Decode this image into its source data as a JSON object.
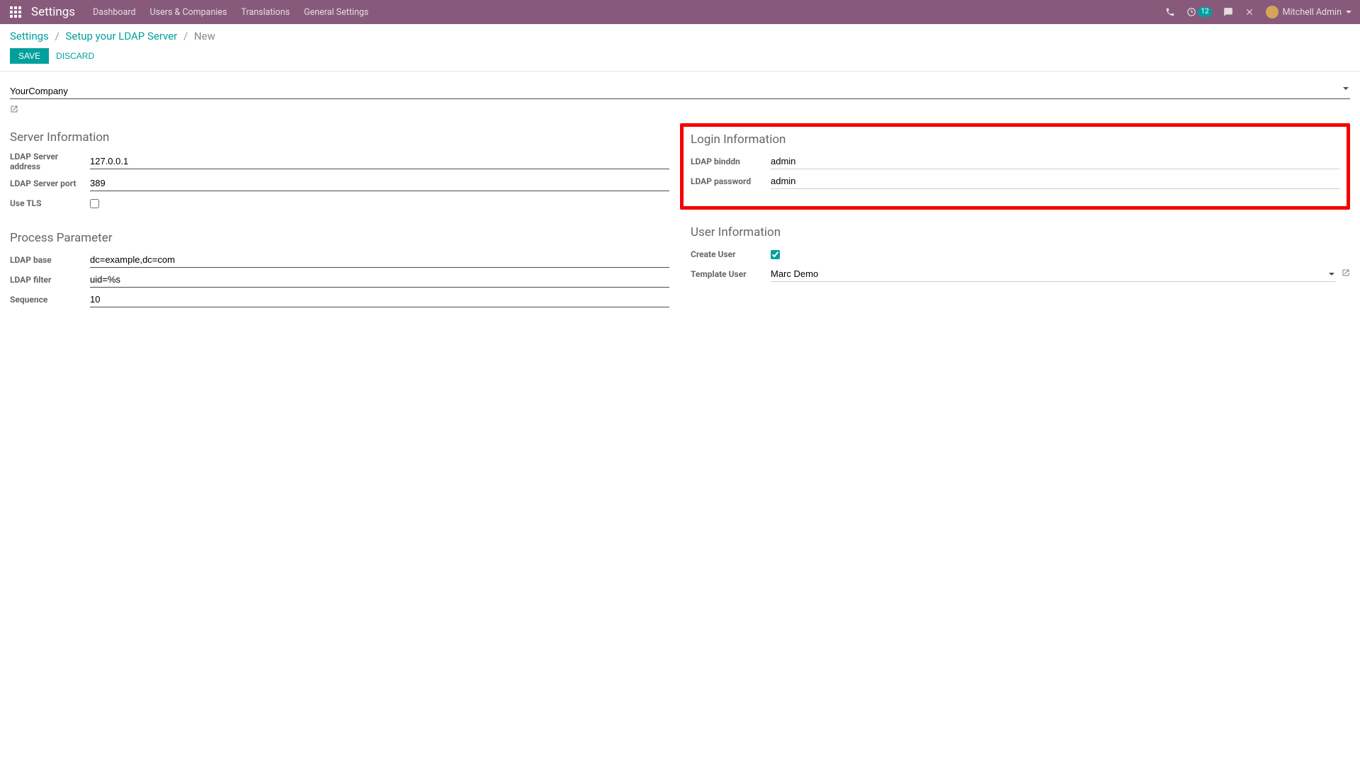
{
  "navbar": {
    "title": "Settings",
    "menu": [
      "Dashboard",
      "Users & Companies",
      "Translations",
      "General Settings"
    ],
    "badge_count": "12",
    "user_name": "Mitchell Admin"
  },
  "breadcrumb": {
    "item1": "Settings",
    "item2": "Setup your LDAP Server",
    "current": "New"
  },
  "buttons": {
    "save": "Save",
    "discard": "Discard"
  },
  "company": {
    "value": "YourCompany"
  },
  "sections": {
    "server": {
      "title": "Server Information",
      "address_label": "LDAP Server address",
      "address_value": "127.0.0.1",
      "port_label": "LDAP Server port",
      "port_value": "389",
      "tls_label": "Use TLS"
    },
    "login": {
      "title": "Login Information",
      "binddn_label": "LDAP binddn",
      "binddn_value": "admin",
      "password_label": "LDAP password",
      "password_value": "admin"
    },
    "process": {
      "title": "Process Parameter",
      "base_label": "LDAP base",
      "base_value": "dc=example,dc=com",
      "filter_label": "LDAP filter",
      "filter_value": "uid=%s",
      "sequence_label": "Sequence",
      "sequence_value": "10"
    },
    "user": {
      "title": "User Information",
      "create_label": "Create User",
      "template_label": "Template User",
      "template_value": "Marc Demo"
    }
  }
}
